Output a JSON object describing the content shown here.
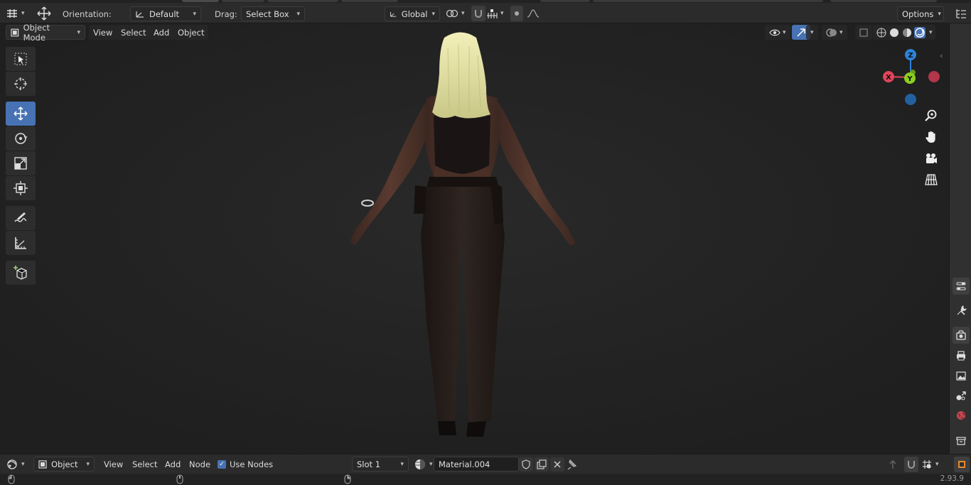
{
  "header": {
    "orientation_label": "Orientation:",
    "orientation_value": "Default",
    "drag_label": "Drag:",
    "drag_value": "Select Box",
    "transform_orientation": "Global",
    "options_label": "Options"
  },
  "viewport_header": {
    "mode": "Object Mode",
    "menus": [
      "View",
      "Select",
      "Add",
      "Object"
    ]
  },
  "toolbar": {
    "tools": [
      "select-box",
      "cursor",
      "move",
      "rotate",
      "scale",
      "transform",
      "annotate",
      "measure",
      "add-cube"
    ],
    "active_tool": "move"
  },
  "gizmo": {
    "x_label": "X",
    "y_label": "Y",
    "z_label": "Z",
    "colors": {
      "x": "#e2455a",
      "y": "#8ccf1f",
      "z": "#2c83d9"
    }
  },
  "node_header": {
    "editor_type": "Object",
    "menus": [
      "View",
      "Select",
      "Add",
      "Node"
    ],
    "use_nodes_label": "Use Nodes",
    "use_nodes_checked": true,
    "slot": "Slot 1",
    "material": "Material.004"
  },
  "status": {
    "version": "2.93.9"
  },
  "colors": {
    "accent": "#4772b3",
    "viewport_bg": "#242424",
    "header_bg": "#2b2b2b"
  }
}
